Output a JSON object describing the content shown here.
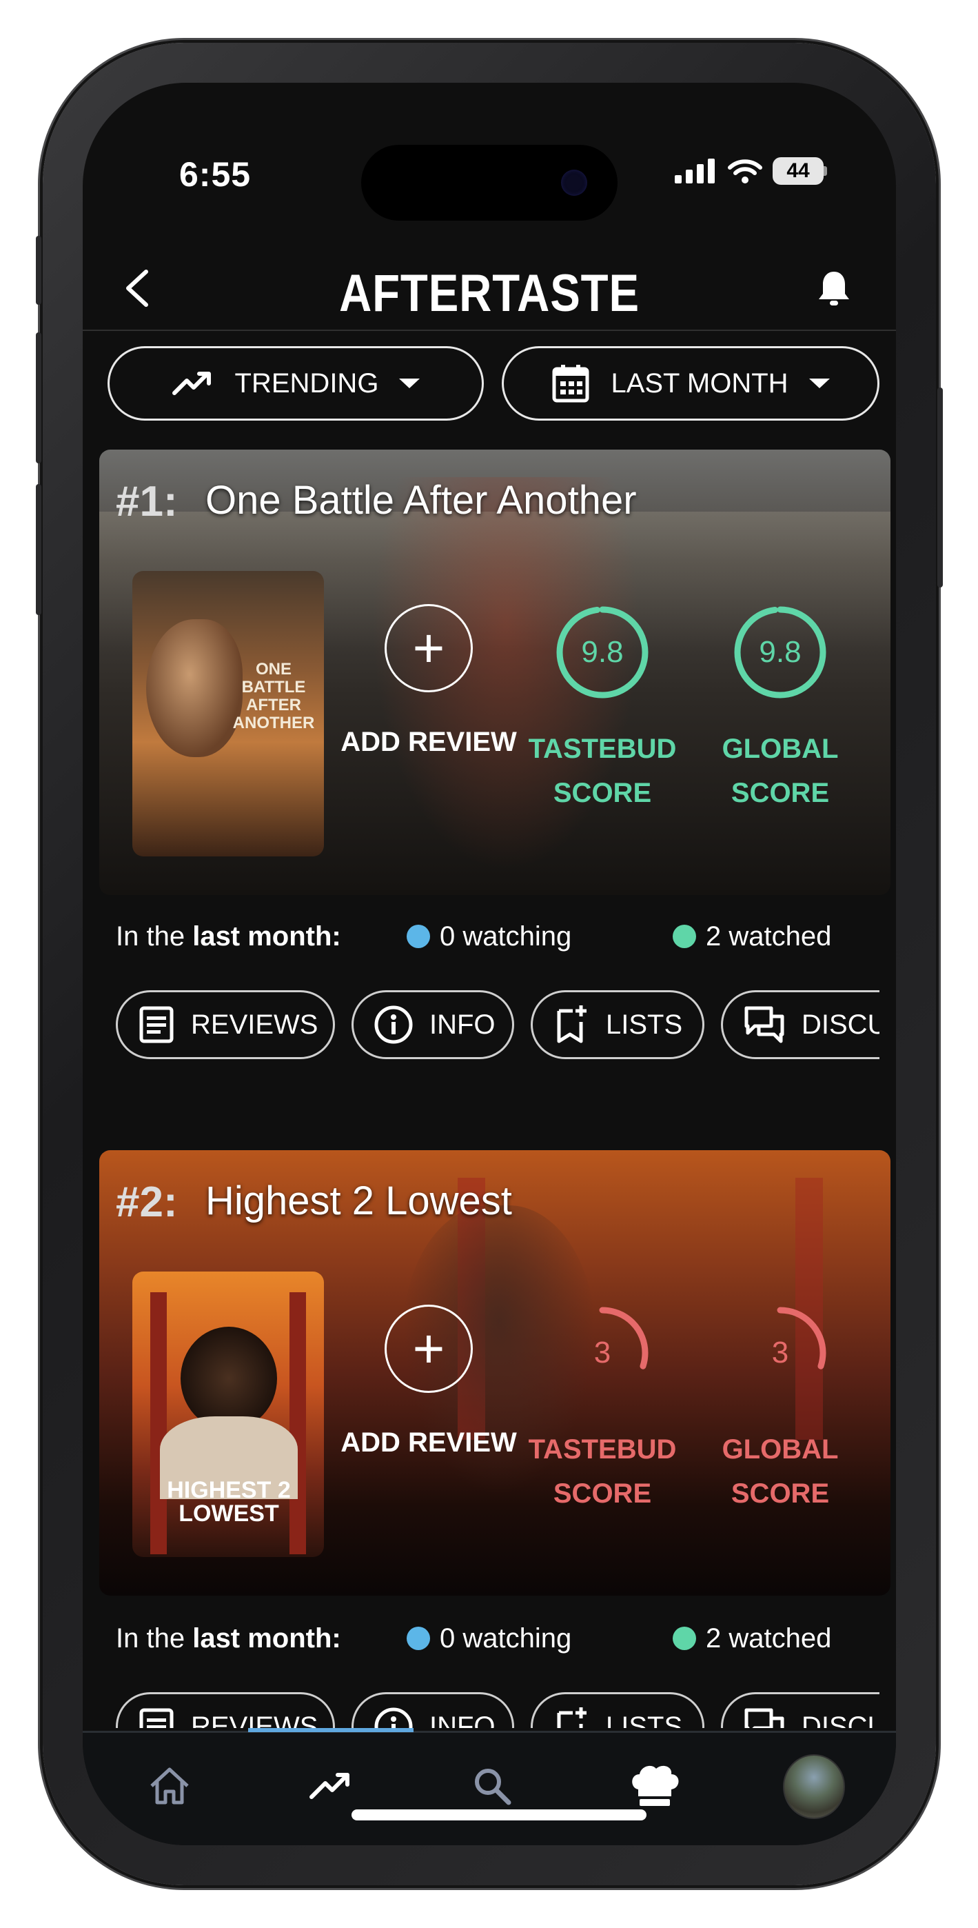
{
  "status": {
    "time": "6:55",
    "battery": "44"
  },
  "header": {
    "title": "AFTERTASTE"
  },
  "filters": [
    {
      "icon": "trending-up-icon",
      "label": "TRENDING"
    },
    {
      "icon": "calendar-icon",
      "label": "LAST MONTH"
    }
  ],
  "movies": [
    {
      "rank": "#1:",
      "title": "One Battle After Another",
      "poster_text": "ONE BATTLE AFTER ANOTHER",
      "add_review": "ADD REVIEW",
      "tastebud_score": "9.8",
      "tastebud_label": "TASTEBUD SCORE",
      "global_score": "9.8",
      "global_label": "GLOBAL SCORE",
      "score_fraction": 0.98,
      "score_color": "#5fd6a8",
      "meta_prefix": "In the ",
      "meta_bold": "last month:",
      "watching": "0 watching",
      "watched": "2 watched"
    },
    {
      "rank": "#2:",
      "title": "Highest 2 Lowest",
      "poster_text": "HIGHEST 2 LOWEST",
      "add_review": "ADD REVIEW",
      "tastebud_score": "3",
      "tastebud_label": "TASTEBUD SCORE",
      "global_score": "3",
      "global_label": "GLOBAL SCORE",
      "score_fraction": 0.3,
      "score_color": "#e66a6a",
      "meta_prefix": "In the ",
      "meta_bold": "last month:",
      "watching": "0 watching",
      "watched": "2 watched"
    }
  ],
  "actions": [
    {
      "icon": "reviews-icon",
      "label": "REVIEWS"
    },
    {
      "icon": "info-icon",
      "label": "INFO"
    },
    {
      "icon": "add-to-list-icon",
      "label": "LISTS"
    },
    {
      "icon": "discussion-icon",
      "label": "DISCU"
    }
  ],
  "tabs": [
    {
      "icon": "home-icon"
    },
    {
      "icon": "trending-icon"
    },
    {
      "icon": "search-icon"
    },
    {
      "icon": "chef-hat-icon"
    },
    {
      "icon": "profile-avatar"
    }
  ],
  "colors": {
    "watching_dot": "#5cb6e8",
    "watched_dot": "#5fd6a8",
    "active_tab": "#5fa8e0"
  }
}
